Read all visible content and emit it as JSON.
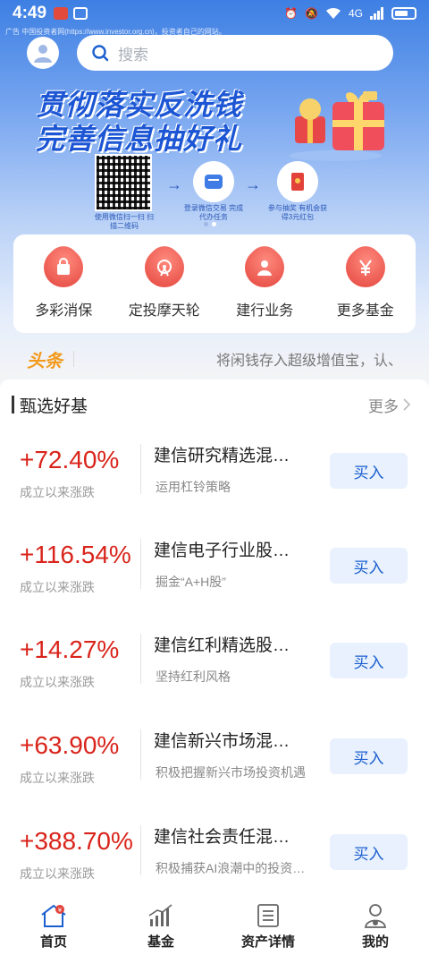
{
  "status_bar": {
    "time": "4:49",
    "network": "4G",
    "icons": [
      "alarm-icon",
      "mute-icon",
      "wifi-icon",
      "signal-icon",
      "battery-icon"
    ]
  },
  "ad_notice": "广告 中国投资者网(https://www.investor.org.cn)，投资者自己的网站。",
  "search": {
    "placeholder": "搜索"
  },
  "banner": {
    "line1": "贯彻落实反洗钱",
    "line2": "完善信息抽好礼",
    "qr_caption": "使用微信扫一扫 扫描二维码",
    "step1_caption": "登录微信交易 完成代办任务",
    "step2_caption": "参与抽奖 有机会获得3元红包",
    "carousel_pages": 2,
    "carousel_active": 1
  },
  "quick_actions": [
    {
      "label": "多彩消保",
      "icon": "bag-icon"
    },
    {
      "label": "定投摩天轮",
      "icon": "ferris-wheel-icon"
    },
    {
      "label": "建行业务",
      "icon": "person-icon"
    },
    {
      "label": "更多基金",
      "icon": "yen-icon"
    }
  ],
  "headline": {
    "tag": "头条",
    "text": "将闲钱存入超级增值宝，认、"
  },
  "funds_section": {
    "title": "甄选好基",
    "more": "更多",
    "rate_label": "成立以来涨跌",
    "buy_label": "买入",
    "items": [
      {
        "rate": "+72.40%",
        "name": "建信研究精选混…",
        "desc": "运用杠铃策略"
      },
      {
        "rate": "+116.54%",
        "name": "建信电子行业股…",
        "desc": "掘金“A+H股”"
      },
      {
        "rate": "+14.27%",
        "name": "建信红利精选股…",
        "desc": "坚持红利风格"
      },
      {
        "rate": "+63.90%",
        "name": "建信新兴市场混…",
        "desc": "积极把握新兴市场投资机遇"
      },
      {
        "rate": "+388.70%",
        "name": "建信社会责任混…",
        "desc": "积极捕获AI浪潮中的投资…"
      }
    ]
  },
  "colors": {
    "accent": "#1b5fcf",
    "rise": "#d9241b",
    "headline_tag": "#f39a1d"
  },
  "tabbar": {
    "active": 0,
    "tabs": [
      {
        "label": "首页",
        "icon": "home-icon"
      },
      {
        "label": "基金",
        "icon": "chart-icon"
      },
      {
        "label": "资产详情",
        "icon": "list-icon"
      },
      {
        "label": "我的",
        "icon": "profile-icon"
      }
    ]
  }
}
